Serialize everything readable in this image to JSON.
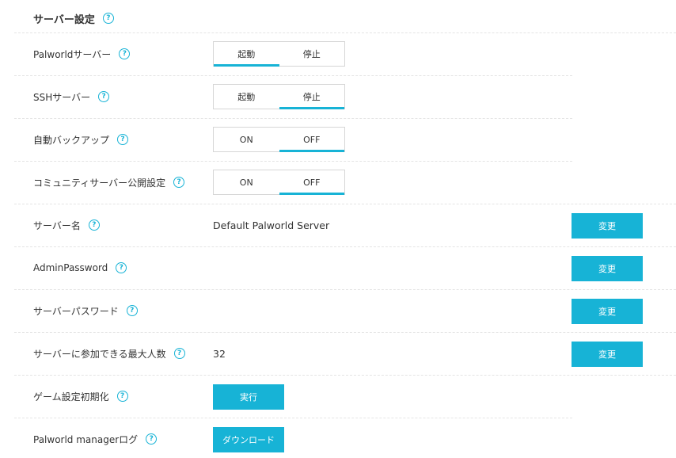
{
  "section": {
    "title": "サーバー設定",
    "help": "?"
  },
  "rows": [
    {
      "label": "Palworldサーバー",
      "help": "?",
      "toggle": [
        "起動",
        "停止"
      ],
      "active": 0
    },
    {
      "label": "SSHサーバー",
      "help": "?",
      "toggle": [
        "起動",
        "停止"
      ],
      "active": 1
    },
    {
      "label": "自動バックアップ",
      "help": "?",
      "toggle": [
        "ON",
        "OFF"
      ],
      "active": 1
    },
    {
      "label": "コミュニティサーバー公開設定",
      "help": "?",
      "toggle": [
        "ON",
        "OFF"
      ],
      "active": 1
    },
    {
      "label": "サーバー名",
      "help": "?",
      "value": "Default Palworld Server",
      "button": "変更"
    },
    {
      "label": "AdminPassword",
      "help": "?",
      "value": "",
      "button": "変更"
    },
    {
      "label": "サーバーパスワード",
      "help": "?",
      "value": "",
      "button": "変更"
    },
    {
      "label": "サーバーに参加できる最大人数",
      "help": "?",
      "value": "32",
      "button": "変更"
    },
    {
      "label": "ゲーム設定初期化",
      "help": "?",
      "button": "実行"
    },
    {
      "label": "Palworld managerログ",
      "help": "?",
      "button": "ダウンロード"
    }
  ],
  "colors": {
    "accent": "#17b3d6",
    "text": "#333333",
    "border": "#d6d6d6"
  }
}
